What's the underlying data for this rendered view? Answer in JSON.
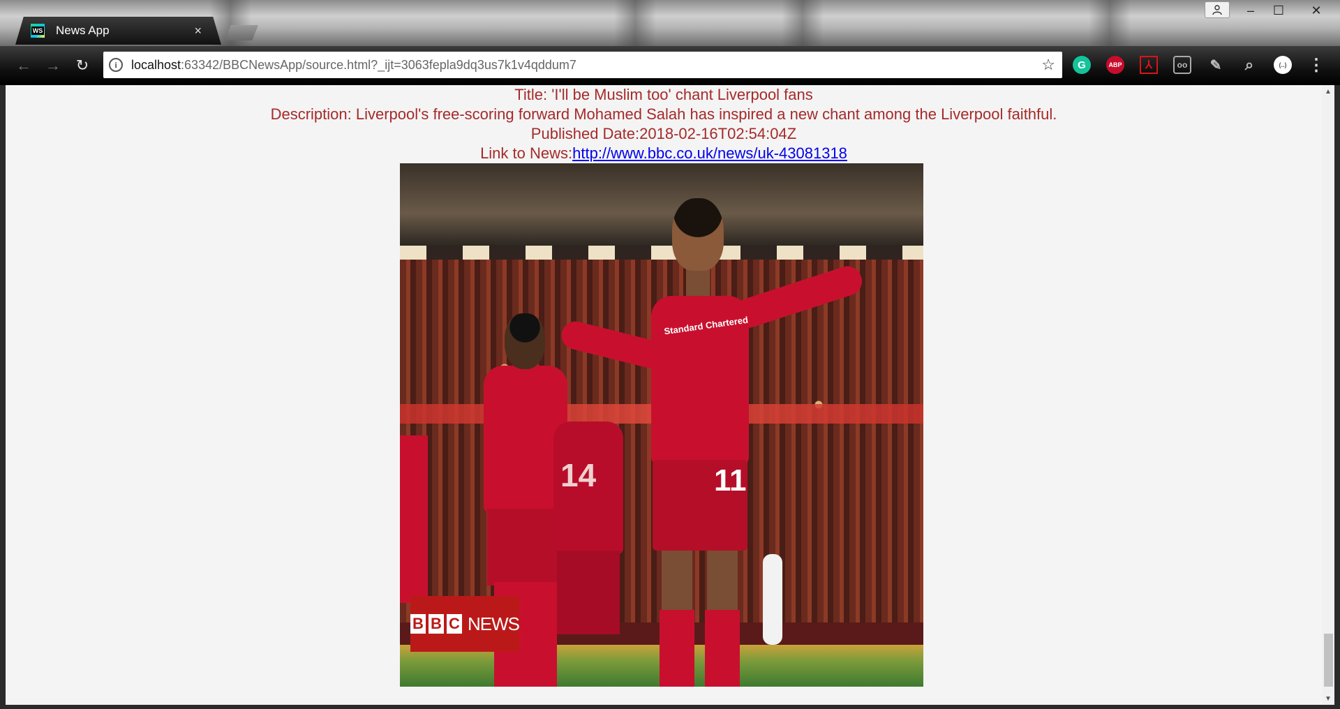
{
  "browser": {
    "tab": {
      "favicon_text": "WS",
      "title": "News App",
      "close_glyph": "×"
    },
    "window_controls": {
      "profile_icon": "person-icon",
      "minimize": "–",
      "maximize": "☐",
      "close": "✕"
    },
    "toolbar": {
      "back_glyph": "←",
      "forward_glyph": "→",
      "reload_glyph": "↻",
      "info_glyph": "i",
      "url_host": "localhost",
      "url_rest": ":63342/BBCNewsApp/source.html?_ijt=3063fepla9dq3us7k1v4qddum7",
      "star_glyph": "☆",
      "extensions": [
        {
          "name": "grammarly-icon",
          "glyph": "G",
          "color": "#15c39a"
        },
        {
          "name": "adblock-icon",
          "glyph": "ABP",
          "color": "#c70d2c"
        },
        {
          "name": "acrobat-icon",
          "glyph": "⅄",
          "color": "#d8141a"
        },
        {
          "name": "glasses-icon",
          "glyph": "oo",
          "color": "#bbbbbb"
        },
        {
          "name": "pen-icon",
          "glyph": "✎",
          "color": "#bbbbbb"
        },
        {
          "name": "magnifier-icon",
          "glyph": "⌕",
          "color": "#bbbbbb"
        },
        {
          "name": "profile-circle-icon",
          "glyph": "(..)",
          "color": "#ffffff"
        }
      ],
      "menu_glyph": "⋮"
    }
  },
  "article": {
    "title_label": "Title: ",
    "title": "'I'll be Muslim too' chant Liverpool fans",
    "description_label": "Description: ",
    "description": "Liverpool's free-scoring forward Mohamed Salah has inspired a new chant among the Liverpool faithful.",
    "published_label": "Published Date:",
    "published": "2018-02-16T02:54:04Z",
    "link_label": "Link to News:",
    "link": "http://www.bbc.co.uk/news/uk-43081318",
    "image": {
      "logo_letters": [
        "B",
        "B",
        "C"
      ],
      "logo_word": "NEWS",
      "sponsor": "Standard Chartered",
      "number_main": "11",
      "number_secondary": "14"
    }
  },
  "colors": {
    "article_text": "#a52a2a",
    "link": "#0000ee",
    "page_bg": "#f4f4f4",
    "bbc_red": "#bb1919"
  }
}
